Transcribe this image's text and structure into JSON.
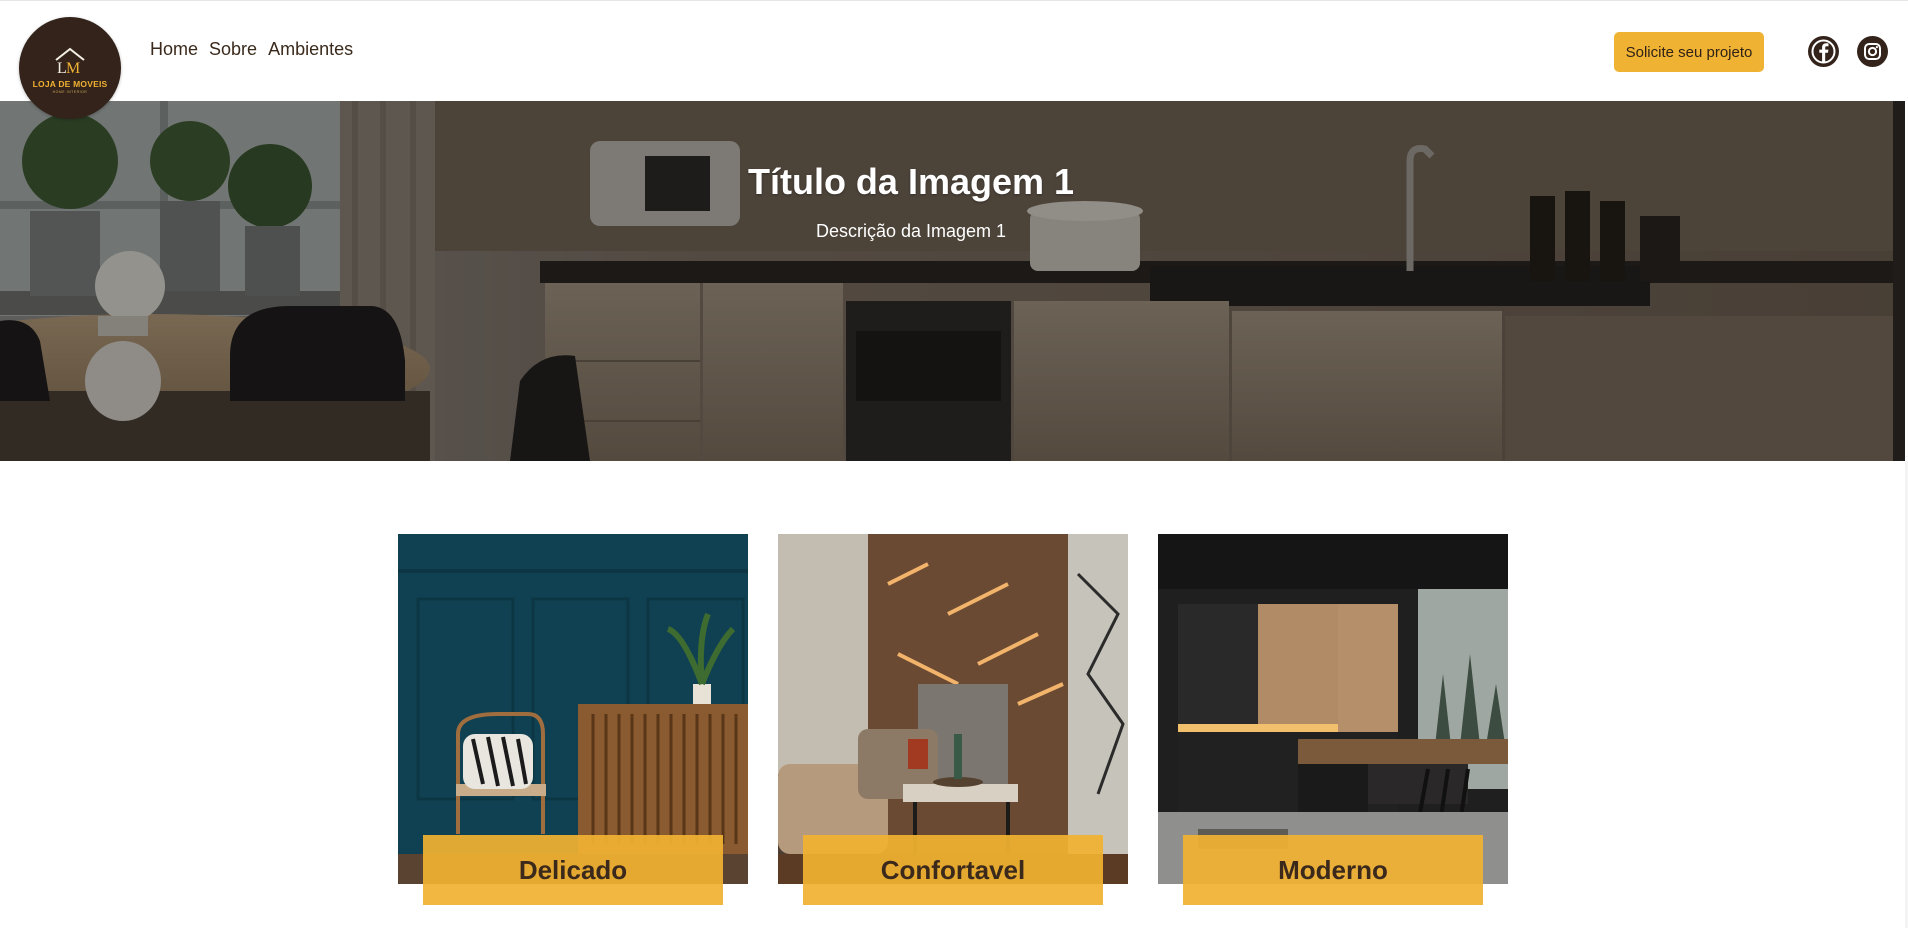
{
  "brand": {
    "logo_text": "LOJA DE MOVEIS",
    "logo_subtext": "HOME INTERIOR",
    "colors": {
      "dark_brown": "#33231a",
      "accent": "#f0b232"
    }
  },
  "nav": {
    "items": [
      {
        "label": "Home"
      },
      {
        "label": "Sobre"
      },
      {
        "label": "Ambientes"
      }
    ]
  },
  "header": {
    "cta_label": "Solicite seu projeto",
    "social": [
      {
        "icon": "facebook-icon"
      },
      {
        "icon": "instagram-icon"
      }
    ]
  },
  "hero": {
    "title": "Título da Imagem 1",
    "description": "Descrição da Imagem 1"
  },
  "cards": [
    {
      "label": "Delicado"
    },
    {
      "label": "Confortavel"
    },
    {
      "label": "Moderno"
    }
  ]
}
